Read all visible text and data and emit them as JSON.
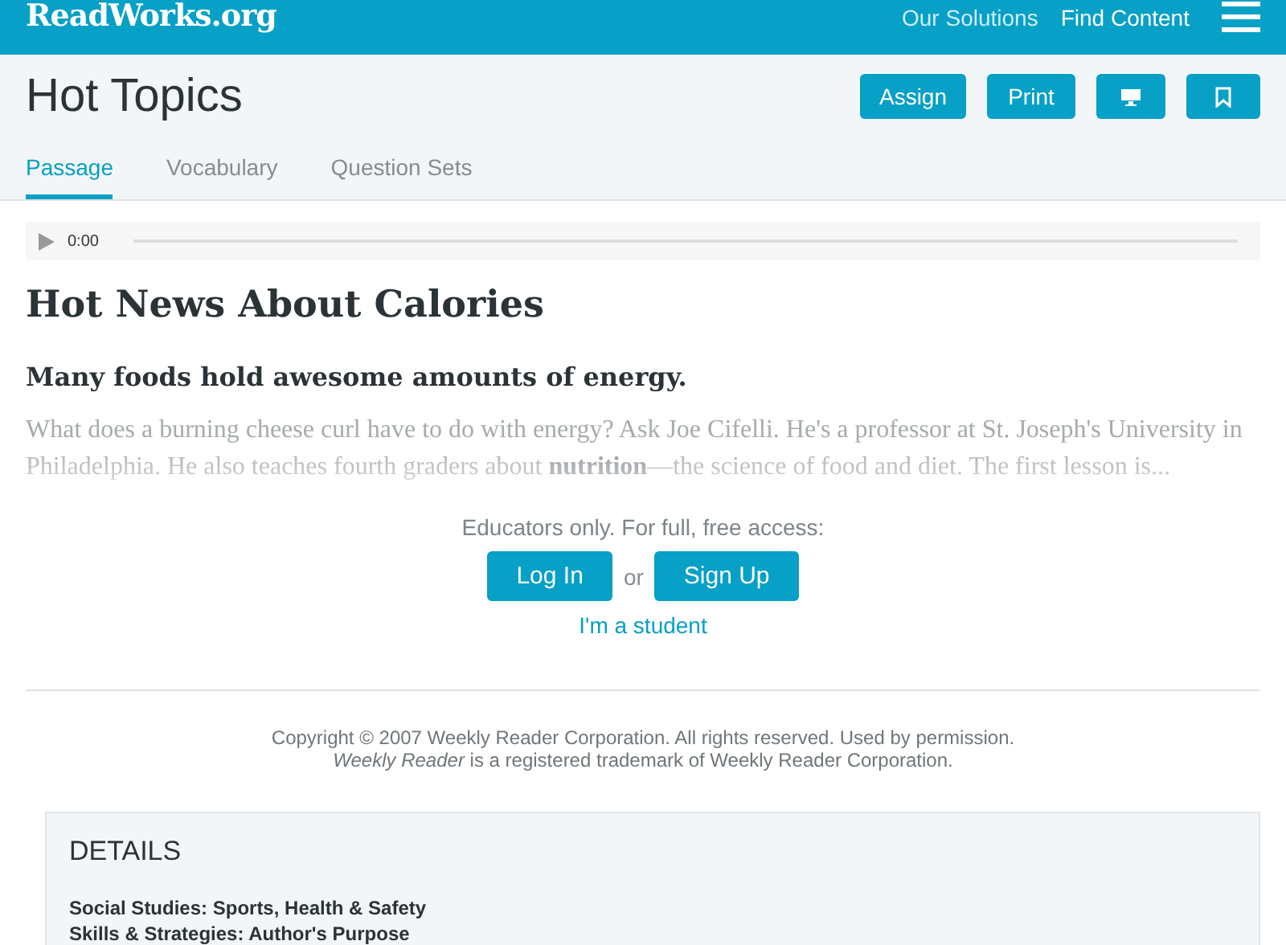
{
  "header": {
    "logo": "ReadWorks.org",
    "nav": [
      "Our Solutions",
      "Find Content"
    ]
  },
  "page": {
    "title": "Hot Topics",
    "actions": [
      {
        "kind": "text",
        "label": "Assign"
      },
      {
        "kind": "text",
        "label": "Print"
      },
      {
        "kind": "screen"
      },
      {
        "kind": "bookmark"
      }
    ]
  },
  "tabs": [
    {
      "label": "Passage",
      "selected": true
    },
    {
      "label": "Vocabulary",
      "selected": false
    },
    {
      "label": "Question Sets",
      "selected": false
    }
  ],
  "audio": {
    "time": "0:00",
    "level": 0
  },
  "article": {
    "title": "Hot News About Calories",
    "subtitle": "Many foods hold awesome amounts of energy.",
    "excerpt": "What does a burning cheese curl have to do with energy? Ask Joe Cifelli. He's a professor at St. Joseph's University in Philadelphia. He also teaches fourth graders about **nutrition**—the science of food and diet. The first lesson is..."
  },
  "access": {
    "prompt": "Educators only. For full, free access:",
    "login": "Log In",
    "or": "or",
    "signup": "Sign Up",
    "student": "I'm a student"
  },
  "copyright": [
    "Copyright © 2007 Weekly Reader Corporation. All rights reserved. Used by permission.",
    "*Weekly Reader* is a registered trademark of Weekly Reader Corporation."
  ],
  "details": {
    "title": "DETAILS",
    "lines": [
      "Social Studies: Sports, Health & Safety",
      "Skills & Strategies: Author's Purpose"
    ]
  }
}
